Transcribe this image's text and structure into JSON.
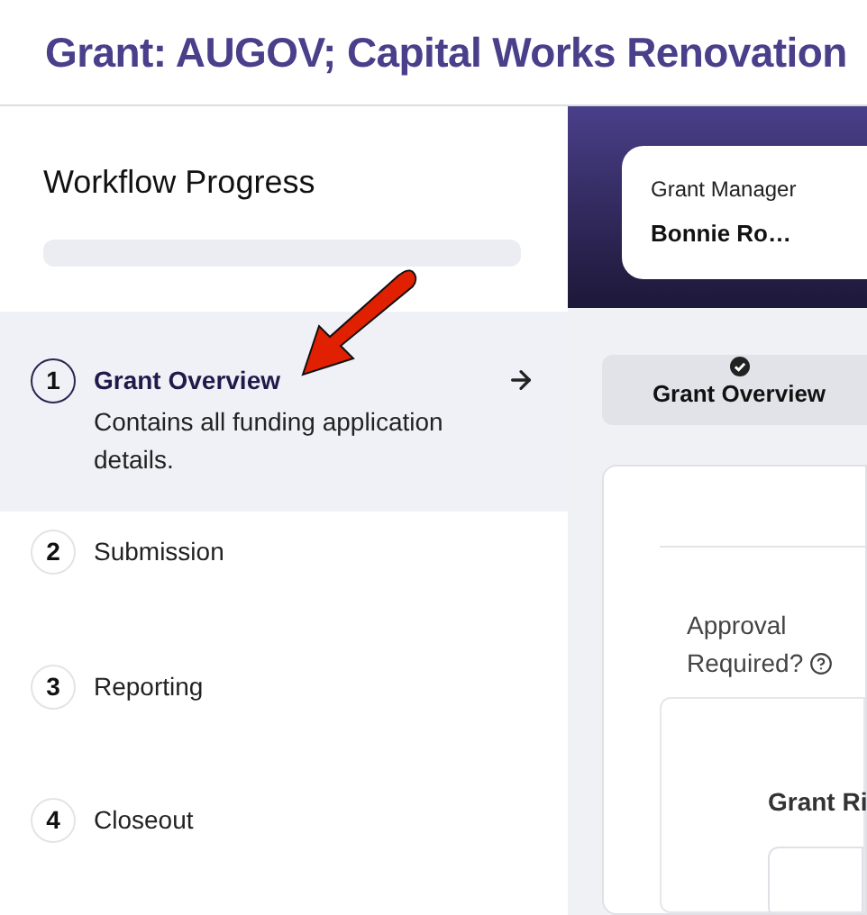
{
  "page_title": "Grant: AUGOV; Capital Works Renovation",
  "workflow": {
    "title": "Workflow Progress",
    "progress": {
      "level": 0
    },
    "steps": [
      {
        "number": "1",
        "label": "Grant Overview",
        "description": "Contains all funding application details.",
        "selected": true
      },
      {
        "number": "2",
        "label": "Submission",
        "selected": false
      },
      {
        "number": "3",
        "label": "Reporting",
        "selected": false
      },
      {
        "number": "4",
        "label": "Closeout",
        "selected": false
      }
    ]
  },
  "manager_card": {
    "label": "Grant Manager",
    "name": "Bonnie Ro…"
  },
  "stage_tab": {
    "label": "Grant Overview",
    "completed": true
  },
  "form": {
    "field_label": "Approval Required?",
    "section_title": "Grant Ri"
  }
}
